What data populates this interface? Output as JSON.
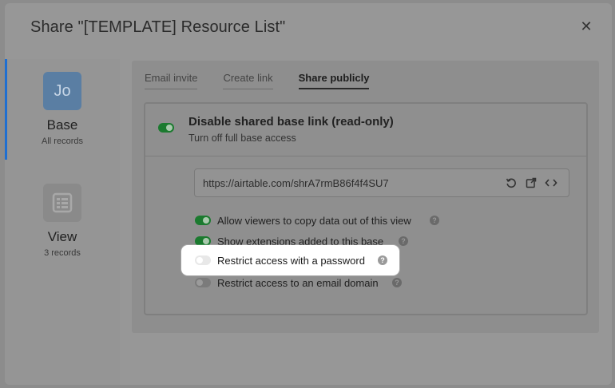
{
  "modal": {
    "title": "Share \"[TEMPLATE] Resource List\"",
    "close_glyph": "✕"
  },
  "sidebar": {
    "items": [
      {
        "avatar": "Jo",
        "name": "Base",
        "sub": "All records"
      },
      {
        "name": "View",
        "sub": "3 records"
      }
    ]
  },
  "tabs": [
    {
      "label": "Email invite"
    },
    {
      "label": "Create link"
    },
    {
      "label": "Share publicly"
    }
  ],
  "card": {
    "title": "Disable shared base link (read-only)",
    "subtitle": "Turn off full base access",
    "link_url": "https://airtable.com/shrA7rmB86f4f4SU7",
    "options": [
      {
        "label": "Allow viewers to copy data out of this view",
        "enabled": true
      },
      {
        "label": "Show extensions added to this base",
        "enabled": true
      },
      {
        "label": "Restrict access with a password",
        "enabled": false
      },
      {
        "label": "Restrict access to an email domain",
        "enabled": false
      }
    ]
  },
  "help_glyph": "?",
  "colors": {
    "accent_blue": "#1f6fd1",
    "toggle_on": "#1b7a2f",
    "highlight": "#ffffff"
  }
}
